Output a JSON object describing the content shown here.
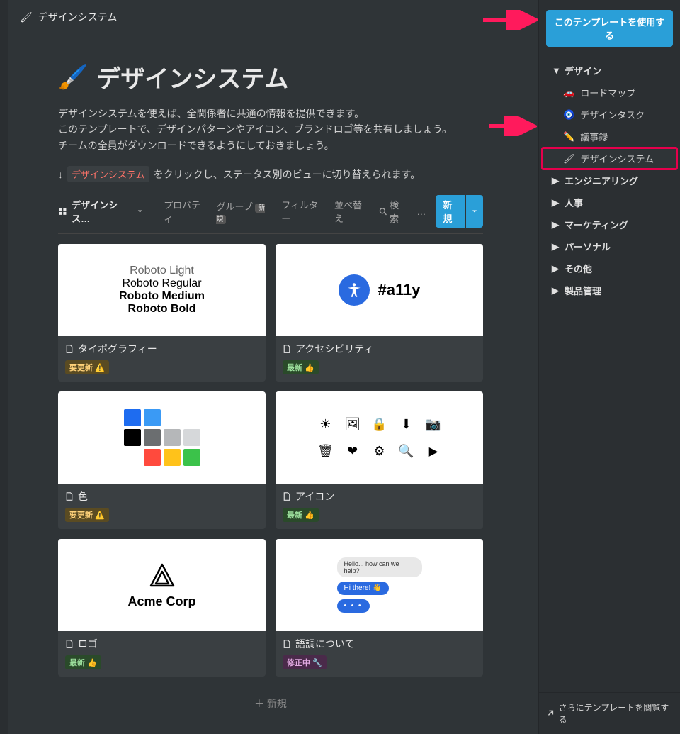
{
  "breadcrumb": {
    "icon": "🖌",
    "title": "デザインシステム"
  },
  "page": {
    "icon": "🖌️",
    "title": "デザインシステム",
    "desc1": "デザインシステムを使えば、全関係者に共通の情報を提供できます。",
    "desc2": "このテンプレートで、デザインパターンやアイコン、ブランドロゴ等を共有しましょう。",
    "desc3": "チームの全員がダウンロードできるようにしておきましょう。",
    "hint_prefix": "↓",
    "hint_link": "デザインシステム",
    "hint_suffix": "をクリックし、ステータス別のビューに切り替えられます。"
  },
  "toolbar": {
    "view_label": "デザインシス…",
    "property": "プロパティ",
    "group": "グループ",
    "group_badge": "新規",
    "filter": "フィルター",
    "sort": "並べ替え",
    "search": "検索",
    "more": "…",
    "new_btn": "新規"
  },
  "cards": [
    {
      "title": "タイポグラフィー",
      "tag": "要更新",
      "tag_emoji": "⚠️",
      "tag_type": "update",
      "preview": "typography"
    },
    {
      "title": "アクセシビリティ",
      "tag": "最新",
      "tag_emoji": "👍",
      "tag_type": "latest",
      "preview": "a11y"
    },
    {
      "title": "色",
      "tag": "要更新",
      "tag_emoji": "⚠️",
      "tag_type": "update",
      "preview": "colors"
    },
    {
      "title": "アイコン",
      "tag": "最新",
      "tag_emoji": "👍",
      "tag_type": "latest",
      "preview": "icons"
    },
    {
      "title": "ロゴ",
      "tag": "最新",
      "tag_emoji": "👍",
      "tag_type": "latest",
      "preview": "logo"
    },
    {
      "title": "語調について",
      "tag": "修正中",
      "tag_emoji": "🔧",
      "tag_type": "fixing",
      "preview": "tone"
    }
  ],
  "new_row": "＋ 新規",
  "typography_lines": [
    "Roboto Light",
    "Roboto Regular",
    "Roboto Medium",
    "Roboto Bold"
  ],
  "a11y_label": "#a11y",
  "logo_label": "Acme Corp",
  "chat": {
    "grey": "Hello... how can we help?",
    "blue": "Hi there! 👋",
    "dots": "• • •"
  },
  "swatch_colors": [
    "#1e6cf0",
    "#3a9af5",
    "",
    "",
    "#000000",
    "#6b6e70",
    "#b5b7b9",
    "#d6d8da",
    "",
    "#ff4a3d",
    "#ffc21a",
    "#3bc24a"
  ],
  "sidebar": {
    "use_template": "このテンプレートを使用する",
    "groups": [
      {
        "label": "デザイン",
        "open": true,
        "children": [
          {
            "icon": "🚗",
            "label": "ロードマップ"
          },
          {
            "icon": "🧿",
            "label": "デザインタスク"
          },
          {
            "icon": "✏️",
            "label": "議事録"
          },
          {
            "icon": "🖌",
            "label": "デザインシステム",
            "highlight": true
          }
        ]
      },
      {
        "label": "エンジニアリング",
        "open": false
      },
      {
        "label": "人事",
        "open": false
      },
      {
        "label": "マーケティング",
        "open": false
      },
      {
        "label": "パーソナル",
        "open": false
      },
      {
        "label": "その他",
        "open": false
      },
      {
        "label": "製品管理",
        "open": false
      }
    ],
    "footer": "さらにテンプレートを閲覧する"
  }
}
